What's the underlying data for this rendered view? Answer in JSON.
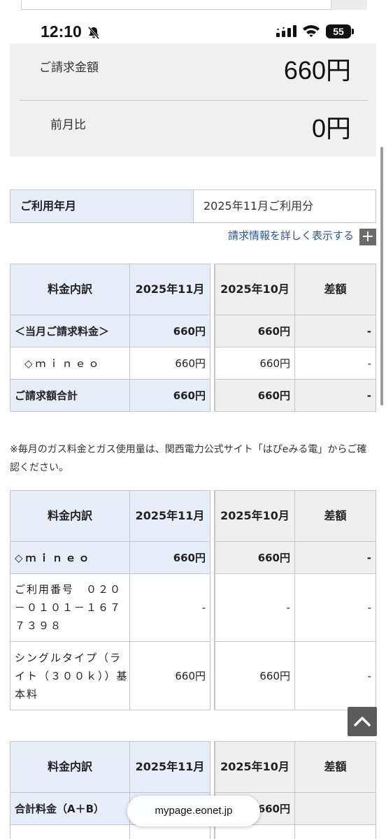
{
  "status_bar": {
    "time": "12:10",
    "battery": "55"
  },
  "summary": {
    "billing_label": "ご請求金額",
    "billing_amount": "660円",
    "diff_label": "前月比",
    "diff_amount": "0円"
  },
  "usage": {
    "label": "ご利用年月",
    "value": "2025年11月ご利用分"
  },
  "detail_link": "請求情報を詳しく表示する",
  "table_header": {
    "item": "料金内訳",
    "current_month": "2025年11月",
    "previous_month": "2025年10月",
    "diff": "差額"
  },
  "table1": {
    "rows": [
      {
        "label": "＜当月ご請求料金＞",
        "current": "660円",
        "previous": "660円",
        "diff": "-"
      },
      {
        "label": "◇ｍｉｎｅｏ",
        "current": "660円",
        "previous": "660円",
        "diff": "-"
      },
      {
        "label": "ご請求額合計",
        "current": "660円",
        "previous": "660円",
        "diff": "-"
      }
    ]
  },
  "note": "※毎月のガス料金とガス使用量は、関西電力公式サイト「はぴeみる電」からご確認ください。",
  "table2": {
    "rows": [
      {
        "label": "◇ｍｉｎｅｏ",
        "current": "660円",
        "previous": "660円",
        "diff": "-"
      },
      {
        "label": "ご利用番号　０２０－０１０１－１６７７３９８",
        "current": "-",
        "previous": "-",
        "diff": "-"
      },
      {
        "label": "シングルタイプ（ライト（３００ｋ））基本料",
        "current": "660円",
        "previous": "660円",
        "diff": "-"
      }
    ]
  },
  "table3": {
    "rows": [
      {
        "label": "合計料金（A＋B）",
        "current": "",
        "previous": "660円",
        "diff": ""
      }
    ]
  },
  "browser": {
    "url": "mypage.eonet.jp"
  },
  "colors": {
    "header_blue": "#e6eefa",
    "header_grey": "#efefef",
    "link_blue": "#2656a8",
    "summary_bg": "#f0f0f0"
  }
}
